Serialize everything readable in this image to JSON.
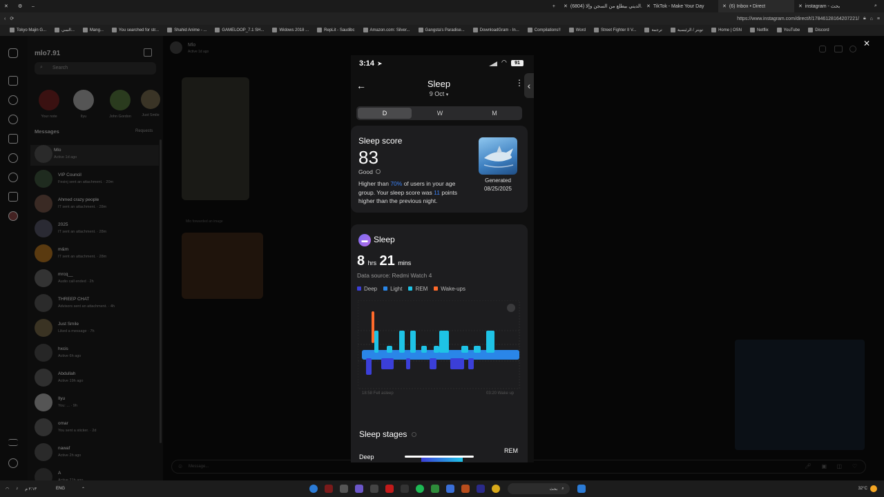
{
  "browser": {
    "tabs": [
      {
        "label": "(6804) الديني بيطلع من السجن وإلا..."
      },
      {
        "label": "TikTok - Make Your Day"
      },
      {
        "label": "(6) Inbox • Direct"
      },
      {
        "label": "instagram - بحث"
      }
    ],
    "url": "https://www.instagram.com/direct/t/17846128164207221/",
    "bookmarks": [
      "Tokyo Majin G...",
      "السي...",
      "Mang...",
      "You searched for str...",
      "Shahid Anime - ...",
      "GAMELOOP_7.1 SH...",
      "Widows 2018 ...",
      "RepLit - Saudibc",
      "Amazon.com: Silver...",
      "Gangsta's Paradise...",
      "DownloadGram - In...",
      "Compilations!!",
      "Word",
      "Street Fighter II V...",
      "ترجمة",
      "تويتر / الرئيسية",
      "Home | OSN",
      "Netflix",
      "YouTube",
      "Discord"
    ]
  },
  "instagram": {
    "username": "mlo7.91",
    "search_placeholder": "Search",
    "notes": [
      {
        "label": "Your note"
      },
      {
        "label": "Ilyu"
      },
      {
        "label": "John Gordon"
      },
      {
        "label": "Just Smile"
      }
    ],
    "messages_header": "Messages",
    "requests_label": "Requests",
    "conversations": [
      {
        "name": "Mlo",
        "sub": "Active 1d ago"
      },
      {
        "name": "VIP Council",
        "sub": "Fesinj sent an attachment. · 20m"
      },
      {
        "name": "Ahmed crazy people",
        "sub": "IT sent an attachment. · 28m"
      },
      {
        "name": "2025",
        "sub": "IT sent an attachment. · 28m"
      },
      {
        "name": "m&m",
        "sub": "IT sent an attachment. · 28m"
      },
      {
        "name": "mrcq__",
        "sub": "Audio call ended · 2h"
      },
      {
        "name": "THREEP CHAT",
        "sub": "Advisors sent an attachment. · 4h"
      },
      {
        "name": "Just Smile",
        "sub": "Liked a message · 7h"
      },
      {
        "name": "hxcis",
        "sub": "Active 6h ago"
      },
      {
        "name": "Abdullah",
        "sub": "Active 19h ago"
      },
      {
        "name": "Ilyu",
        "sub": "You: ... · 9h"
      },
      {
        "name": "omar",
        "sub": "You sent a sticker. · 2d"
      },
      {
        "name": "nawaf",
        "sub": "Active 2h ago"
      },
      {
        "name": "A",
        "sub": "Active 21h ago"
      }
    ],
    "chat_header_name": "Mlo",
    "chat_header_sub": "Active 1d ago",
    "forwarded_label": "Mlo forwarded an image",
    "message_placeholder": "Message..."
  },
  "phone": {
    "status_time": "3:14",
    "battery": "91",
    "title": "Sleep",
    "date": "9 Oct",
    "tabs": [
      "D",
      "W",
      "M"
    ],
    "active_tab": "D",
    "score_card": {
      "title": "Sleep score",
      "score": "83",
      "rating": "Good",
      "desc_1": "Higher than ",
      "desc_pct": "70%",
      "desc_2": " of users in your age group. Your sleep score was ",
      "desc_pts": "11",
      "desc_3": " points higher than the previous night.",
      "generated_label": "Generated",
      "generated_date": "08/25/2025"
    },
    "sleep_card": {
      "title": "Sleep",
      "hours": "8",
      "hours_unit": "hrs",
      "mins": "21",
      "mins_unit": "mins",
      "source": "Data source: Redmi Watch 4",
      "legend": [
        {
          "label": "Deep",
          "color": "#3b3fd8"
        },
        {
          "label": "Light",
          "color": "#2a86e8"
        },
        {
          "label": "REM",
          "color": "#1ec3e6"
        },
        {
          "label": "Wake-ups",
          "color": "#ff6a2b"
        }
      ],
      "start_label": "18:58 Fell asleep",
      "end_label": "03:20 Wake up"
    },
    "stages": {
      "title": "Sleep stages",
      "deep_label": "Deep",
      "rem_label": "REM"
    }
  },
  "taskbar": {
    "lang": "ENG",
    "temp": "32°C",
    "search_label": "بحث",
    "clock": "٢:١٣ م"
  },
  "colors": {
    "accent_blue": "#3b82f6",
    "deep": "#3b3fd8",
    "light": "#2a86e8",
    "rem": "#1ec3e6",
    "wake": "#ff6a2b"
  }
}
